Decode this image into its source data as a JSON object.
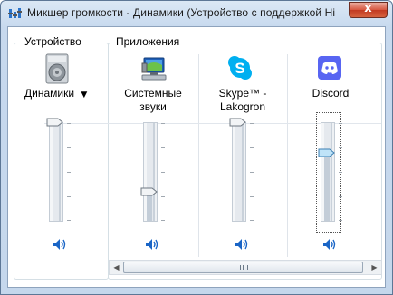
{
  "window": {
    "title": "Микшер громкости - Динамики (Устройство с поддержкой High Definiti",
    "close_glyph": "x"
  },
  "device_group": {
    "label": "Устройство",
    "device": {
      "name": "Динамики",
      "dropdown_glyph": "▼",
      "icon": "speaker-icon",
      "volume_percent": 100,
      "muted": false
    }
  },
  "apps_group": {
    "label": "Приложения",
    "apps": [
      {
        "name": "Системные звуки",
        "icon": "system-sounds-icon",
        "volume_percent": 30,
        "muted": false
      },
      {
        "name": "Skype™ -\nLakogron",
        "icon": "skype-icon",
        "volume_percent": 100,
        "muted": false
      },
      {
        "name": "Discord",
        "icon": "discord-icon",
        "volume_percent": 70,
        "muted": false,
        "focused": true
      }
    ]
  },
  "scrollbar": {
    "left_arrow": "◀",
    "right_arrow": "▶"
  },
  "colors": {
    "skype": "#00aff0",
    "discord": "#5865f2",
    "accent": "#1a65c6"
  }
}
